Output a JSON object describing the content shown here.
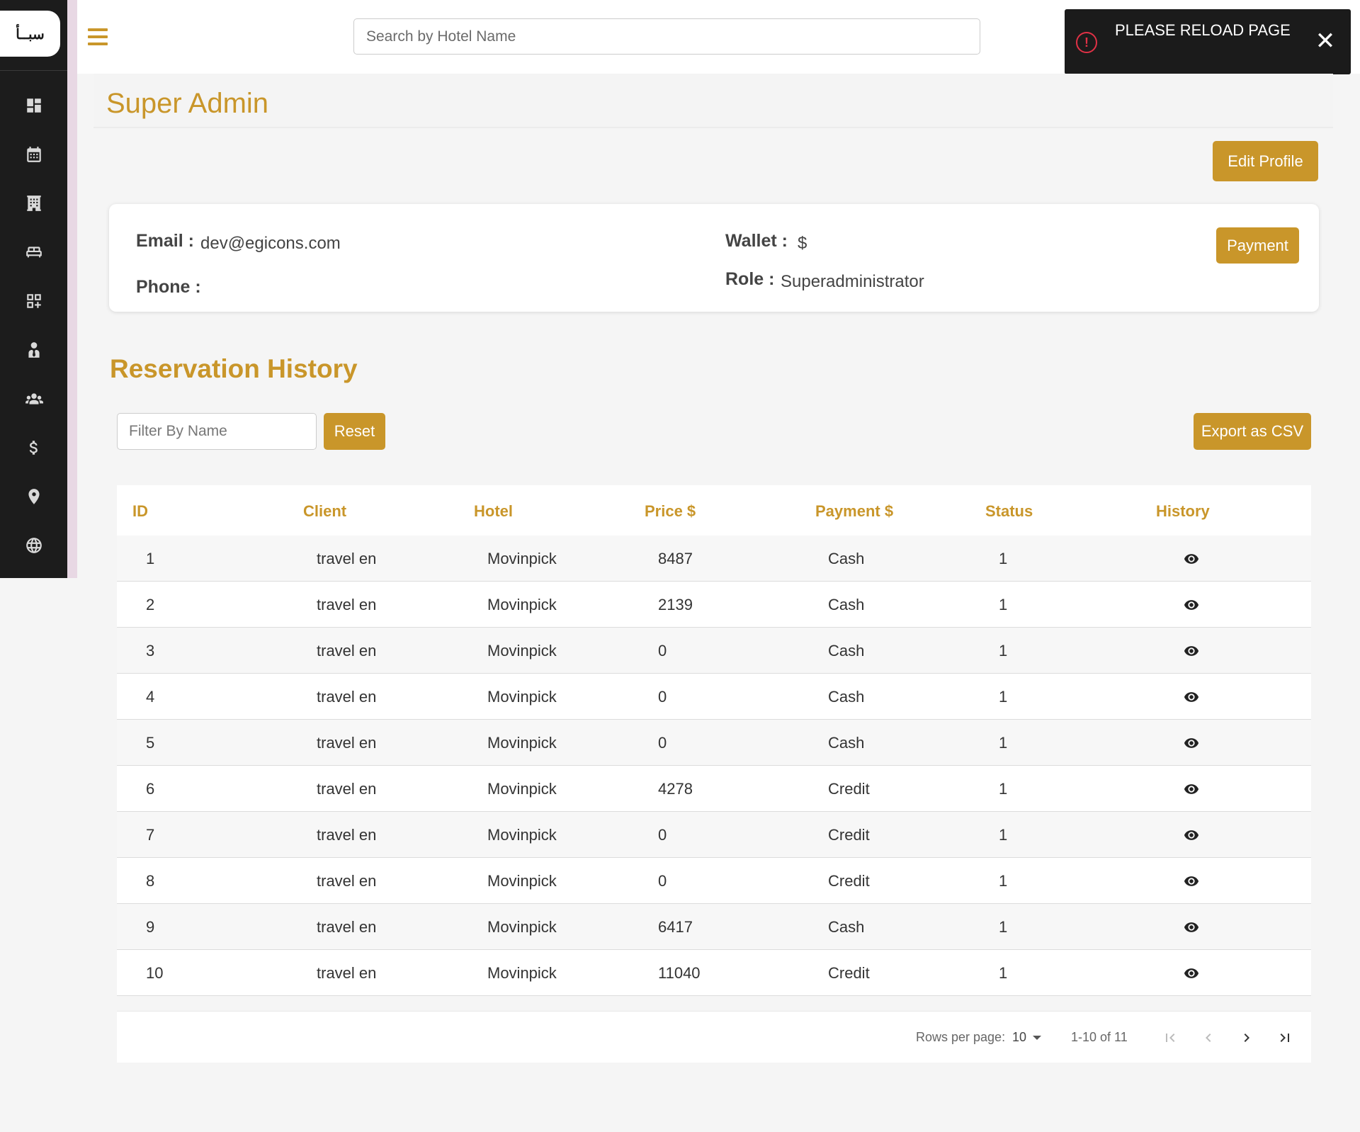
{
  "brand": {
    "logo_text": "سبــأ"
  },
  "sidebar": {
    "items": [
      {
        "icon": "dashboard-icon"
      },
      {
        "icon": "calendar-icon"
      },
      {
        "icon": "hotel-icon"
      },
      {
        "icon": "bed-icon"
      },
      {
        "icon": "widgets-icon"
      },
      {
        "icon": "user-tie-icon"
      },
      {
        "icon": "users-icon"
      },
      {
        "icon": "dollar-icon"
      },
      {
        "icon": "location-pin-icon"
      },
      {
        "icon": "globe-icon"
      }
    ]
  },
  "topbar": {
    "search_placeholder": "Search by Hotel Name"
  },
  "toast": {
    "message": "PLEASE RELOAD PAGE",
    "close_glyph": "✕",
    "alert_glyph": "!"
  },
  "page": {
    "title": "Super Admin",
    "edit_profile_label": "Edit Profile"
  },
  "profile": {
    "email_label": "Email :",
    "email_value": "dev@egicons.com",
    "phone_label": "Phone :",
    "phone_value": "",
    "wallet_label": "Wallet :",
    "wallet_value": "$",
    "role_label": "Role :",
    "role_value": "Superadministrator",
    "payment_label": "Payment"
  },
  "reservations": {
    "title": "Reservation History",
    "filter_placeholder": "Filter By Name",
    "reset_label": "Reset",
    "export_label": "Export as CSV",
    "columns": [
      "ID",
      "Client",
      "Hotel",
      "Price $",
      "Payment $",
      "Status",
      "History"
    ],
    "rows": [
      {
        "id": "1",
        "client": "travel en",
        "hotel": "Movinpick",
        "price": "8487",
        "payment": "Cash",
        "status": "1"
      },
      {
        "id": "2",
        "client": "travel en",
        "hotel": "Movinpick",
        "price": "2139",
        "payment": "Cash",
        "status": "1"
      },
      {
        "id": "3",
        "client": "travel en",
        "hotel": "Movinpick",
        "price": "0",
        "payment": "Cash",
        "status": "1"
      },
      {
        "id": "4",
        "client": "travel en",
        "hotel": "Movinpick",
        "price": "0",
        "payment": "Cash",
        "status": "1"
      },
      {
        "id": "5",
        "client": "travel en",
        "hotel": "Movinpick",
        "price": "0",
        "payment": "Cash",
        "status": "1"
      },
      {
        "id": "6",
        "client": "travel en",
        "hotel": "Movinpick",
        "price": "4278",
        "payment": "Credit",
        "status": "1"
      },
      {
        "id": "7",
        "client": "travel en",
        "hotel": "Movinpick",
        "price": "0",
        "payment": "Credit",
        "status": "1"
      },
      {
        "id": "8",
        "client": "travel en",
        "hotel": "Movinpick",
        "price": "0",
        "payment": "Credit",
        "status": "1"
      },
      {
        "id": "9",
        "client": "travel en",
        "hotel": "Movinpick",
        "price": "6417",
        "payment": "Cash",
        "status": "1"
      },
      {
        "id": "10",
        "client": "travel en",
        "hotel": "Movinpick",
        "price": "11040",
        "payment": "Credit",
        "status": "1"
      }
    ]
  },
  "pagination": {
    "rows_per_page_label": "Rows per page:",
    "rows_per_page_value": "10",
    "range_text": "1-10 of 11"
  },
  "colors": {
    "accent": "#c9962a",
    "sidebar_bg": "#1c1c1c",
    "toast_bg": "#1b1b1b",
    "alert": "#e03146"
  }
}
